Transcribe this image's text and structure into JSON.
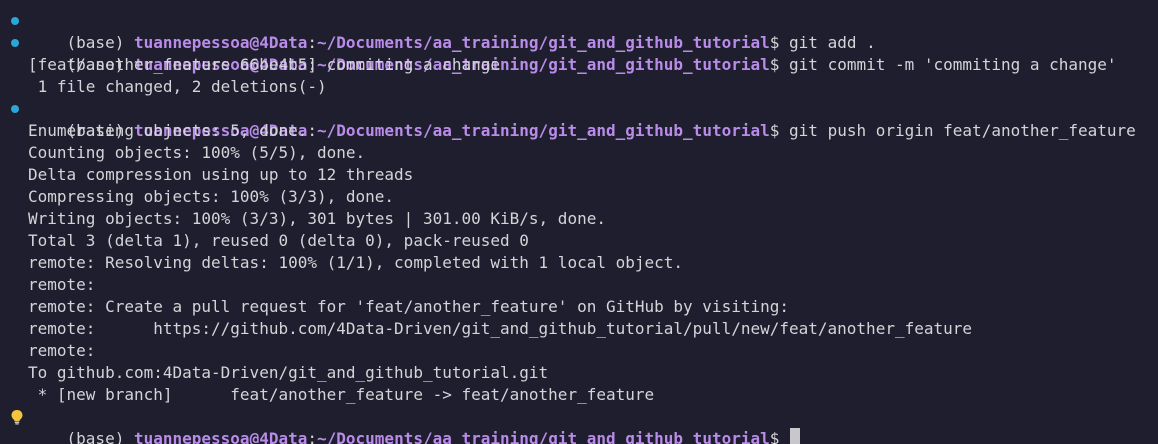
{
  "colors": {
    "background": "#1f1e2e",
    "text": "#d4d4d8",
    "prompt_user_path": "#b88ce8",
    "success_dot": "#2aa7d6",
    "bulb": "#f2c53d"
  },
  "prompt": {
    "env": "(base)",
    "user_host": "tuannepessoa@4Data",
    "colon": ":",
    "path": "~/Documents/aa_training/git_and_github_tutorial",
    "symbol": "$"
  },
  "commands": [
    "git add .",
    "git commit -m 'commiting a change'",
    "git push origin feat/another_feature"
  ],
  "output": {
    "commit": [
      "[feat/another_feature 66be4b5] commiting a change",
      " 1 file changed, 2 deletions(-)"
    ],
    "push": [
      "Enumerating objects: 5, done.",
      "Counting objects: 100% (5/5), done.",
      "Delta compression using up to 12 threads",
      "Compressing objects: 100% (3/3), done.",
      "Writing objects: 100% (3/3), 301 bytes | 301.00 KiB/s, done.",
      "Total 3 (delta 1), reused 0 (delta 0), pack-reused 0",
      "remote: Resolving deltas: 100% (1/1), completed with 1 local object.",
      "remote:",
      "remote: Create a pull request for 'feat/another_feature' on GitHub by visiting:",
      "remote:      https://github.com/4Data-Driven/git_and_github_tutorial/pull/new/feat/another_feature",
      "remote:",
      "To github.com:4Data-Driven/git_and_github_tutorial.git",
      " * [new branch]      feat/another_feature -> feat/another_feature"
    ]
  },
  "icons": {
    "command_status": "success-dot-icon",
    "command_hint": "lightbulb-icon",
    "cursor": "block-cursor"
  }
}
